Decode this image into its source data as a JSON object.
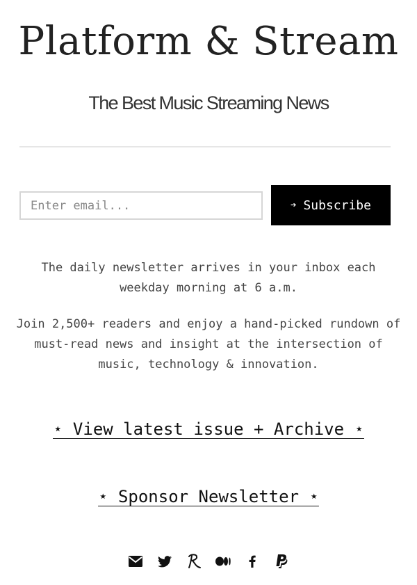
{
  "header": {
    "title": "Platform & Stream",
    "tagline": "The Best Music Streaming News"
  },
  "subscribe": {
    "email_placeholder": "Enter email...",
    "email_value": "",
    "button_icon": "arrow-right-icon",
    "button_arrow": "➔",
    "button_label": "Subscribe"
  },
  "description": {
    "paragraph1": "The daily newsletter arrives in your inbox each weekday morning at 6 a.m.",
    "paragraph2": "Join 2,500+ readers and enjoy a hand-picked rundown of must-read news and insight at the intersection of music, technology & innovation."
  },
  "links": {
    "latest_issue": "⋆ View latest issue + Archive ⋆",
    "sponsor": "⋆ Sponsor Newsletter ⋆"
  },
  "social": [
    {
      "name": "email-icon"
    },
    {
      "name": "twitter-icon"
    },
    {
      "name": "revue-icon"
    },
    {
      "name": "medium-icon"
    },
    {
      "name": "facebook-icon"
    },
    {
      "name": "paypal-icon"
    }
  ],
  "colors": {
    "button_bg": "#000000",
    "button_text": "#ffffff",
    "input_border": "#d6d6d6",
    "divider": "#e6e6e6",
    "body_text": "#444444"
  }
}
